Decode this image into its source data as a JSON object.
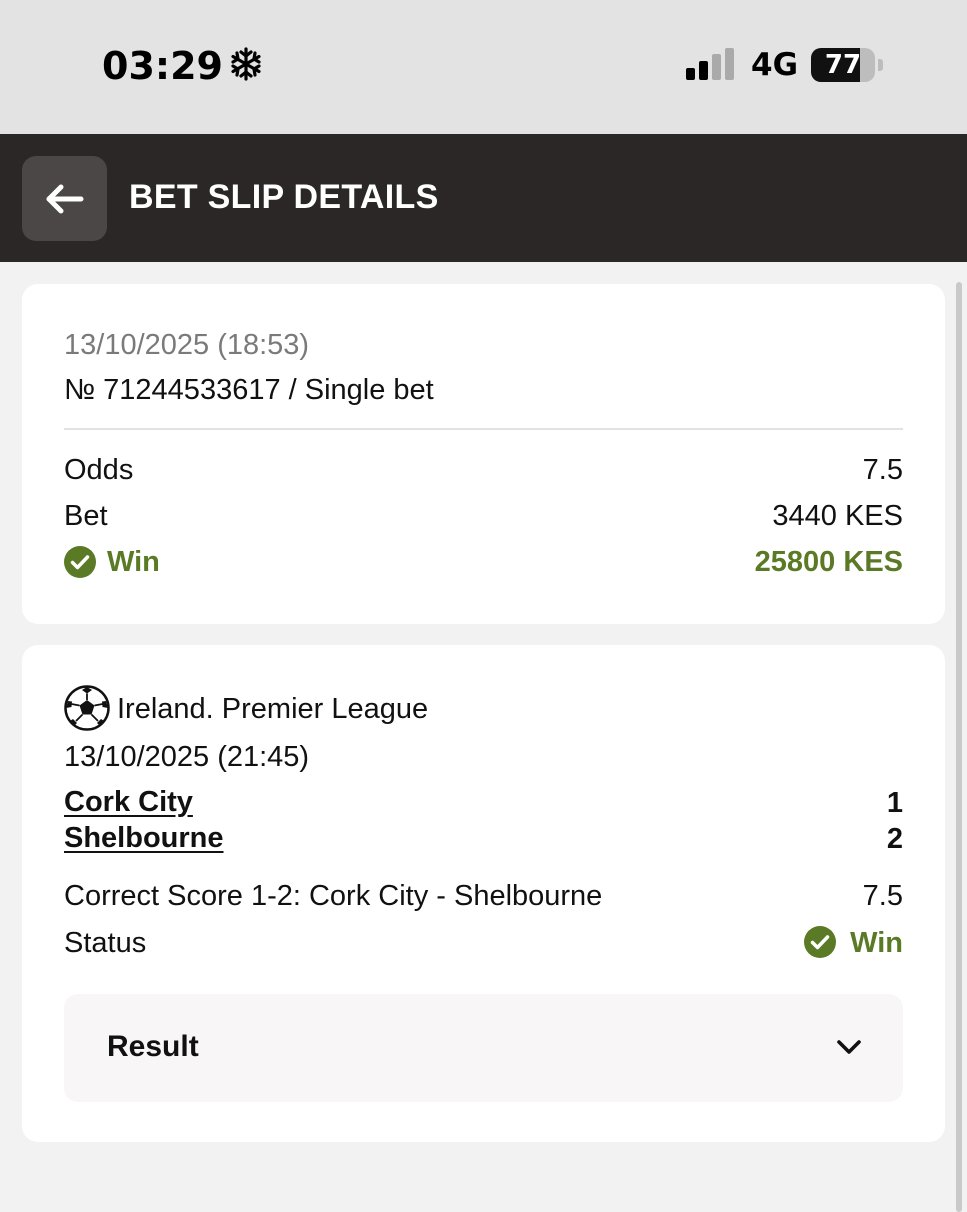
{
  "status_bar": {
    "time": "03:29",
    "network": "4G",
    "battery_level": "77",
    "battery_fraction": 0.77,
    "icons": [
      "snowflake-icon",
      "signal-bars-icon",
      "battery-icon"
    ]
  },
  "header": {
    "title": "BET SLIP DETAILS",
    "back_icon": "arrow-left-icon"
  },
  "summary": {
    "datetime": "13/10/2025 (18:53)",
    "bet_number": "№ 71244533617 / Single bet",
    "odds_label": "Odds",
    "odds_value": "7.5",
    "bet_label": "Bet",
    "bet_value": "3440 KES",
    "win_label": "Win",
    "win_value": "25800 KES"
  },
  "event": {
    "league": "Ireland. Premier League",
    "datetime": "13/10/2025 (21:45)",
    "teams": [
      {
        "name": "Cork City",
        "score": "1"
      },
      {
        "name": "Shelbourne",
        "score": "2"
      }
    ],
    "selection": "Correct Score 1-2: Cork City - Shelbourne",
    "selection_odds": "7.5",
    "status_label": "Status",
    "status_value": "Win",
    "result_label": "Result"
  },
  "colors": {
    "header_bg": "#2a2726",
    "win_green": "#5a7a25",
    "page_bg": "#f2f2f2"
  }
}
